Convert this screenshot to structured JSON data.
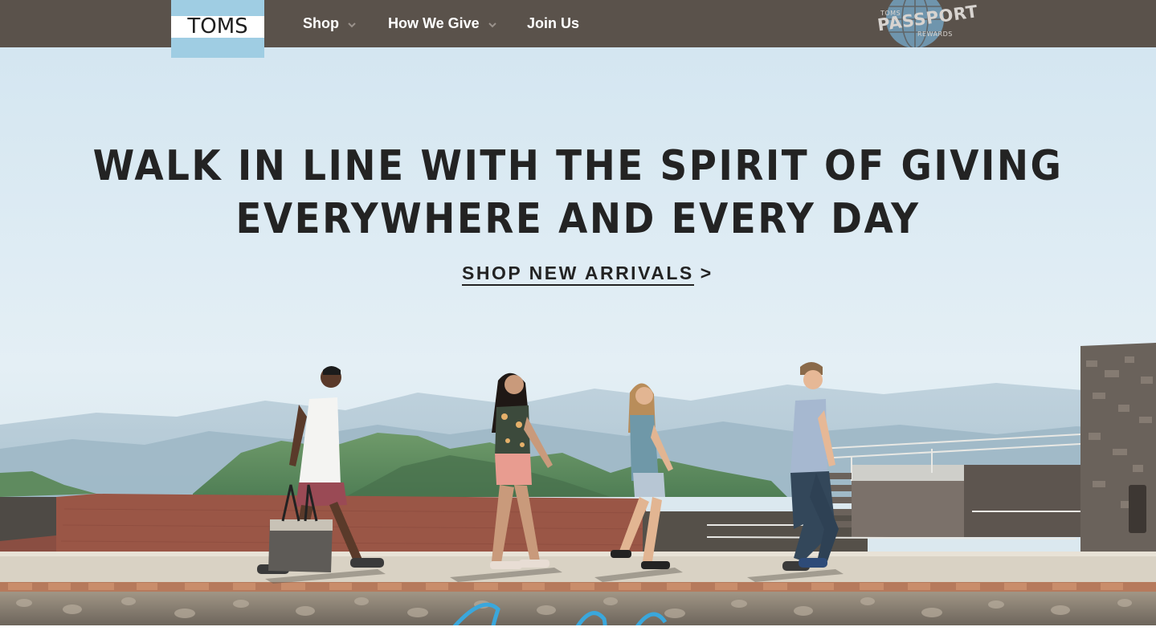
{
  "header": {
    "logo_text": "TOMS",
    "nav": [
      {
        "label": "Shop",
        "has_dropdown": true
      },
      {
        "label": "How We Give",
        "has_dropdown": true
      },
      {
        "label": "Join Us",
        "has_dropdown": false
      }
    ],
    "rewards_badge": {
      "top": "TOMS",
      "main": "PASSPORT",
      "bottom": "REWARDS"
    }
  },
  "hero": {
    "headline_line1": "WALK IN LINE WITH THE SPIRIT OF GIVING",
    "headline_line2": "EVERYWHERE AND EVERY DAY",
    "cta_label": "SHOP NEW ARRIVALS",
    "cta_arrow": ">"
  },
  "colors": {
    "header_bg": "#5a524b",
    "logo_blue": "#9fcde3",
    "sky": "#dcebf3",
    "script_accent": "#3aa7dc"
  }
}
